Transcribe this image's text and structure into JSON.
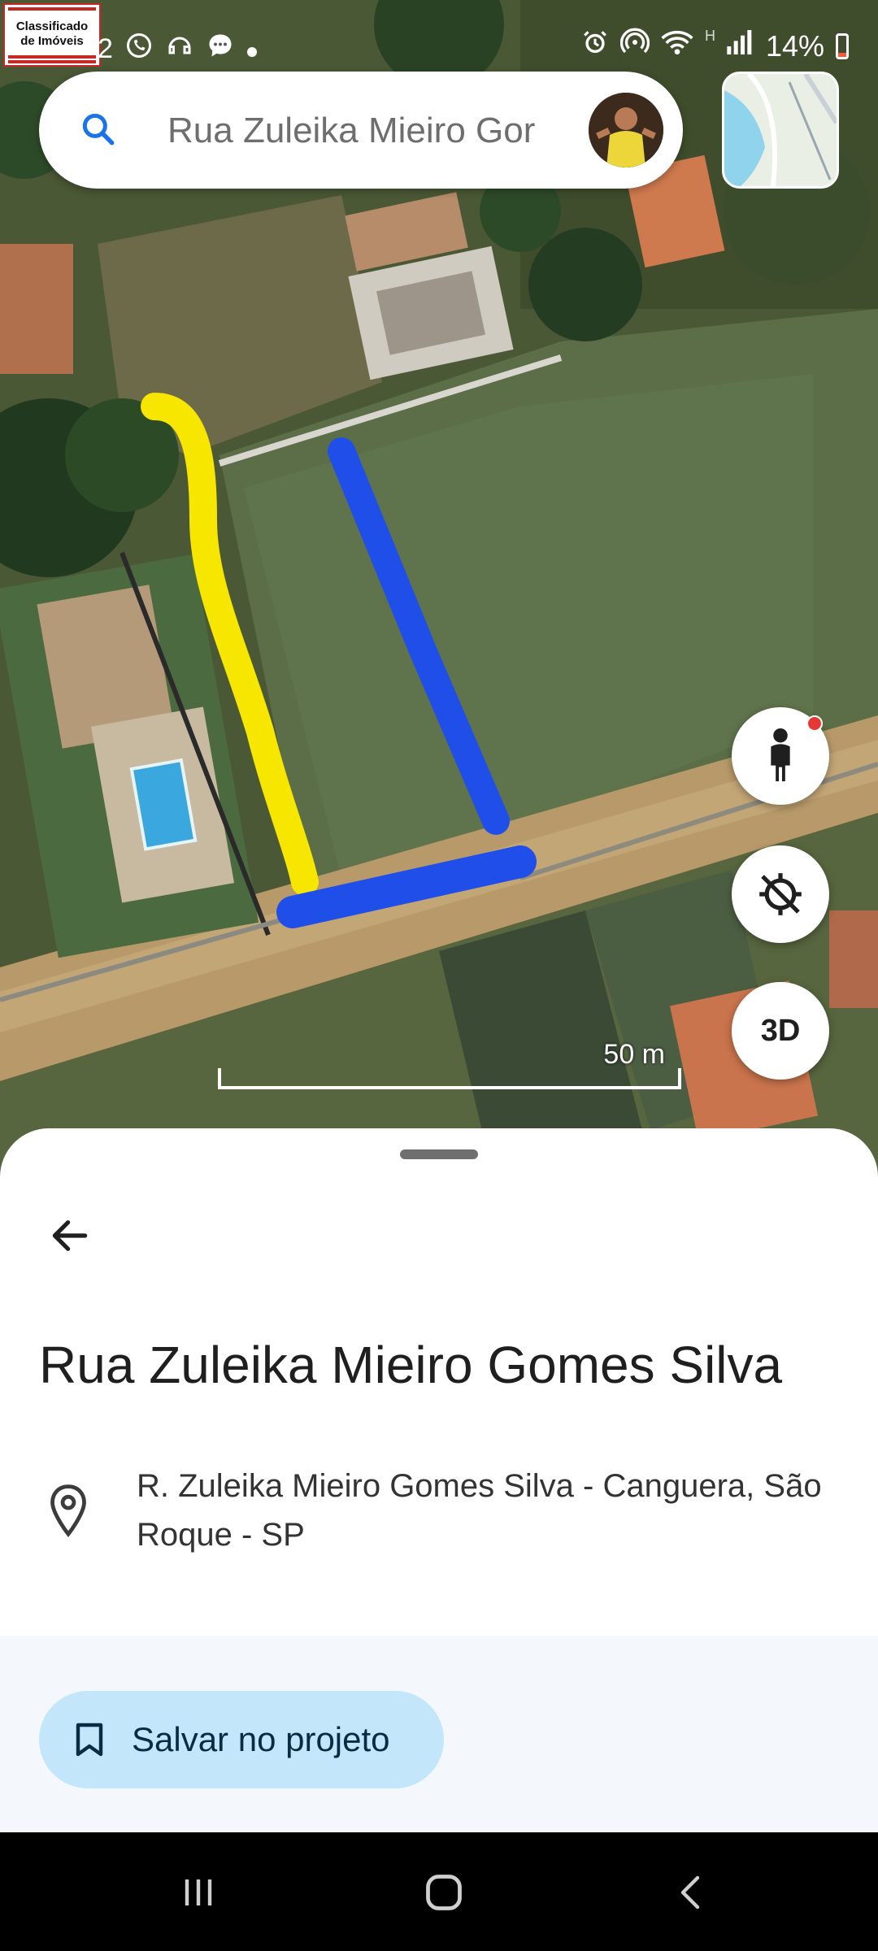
{
  "status_bar": {
    "logo_line1": "Classificado",
    "logo_line2": "de Imóveis",
    "notif_count": "2",
    "battery": "14%",
    "network_label": "H"
  },
  "search": {
    "value": "Rua Zuleika Mieiro Gor",
    "icon": "search-icon"
  },
  "map": {
    "scale_label": "50 m",
    "three_d_label": "3D",
    "markings": [
      {
        "name": "yellow-boundary-line",
        "color": "#f7e600"
      },
      {
        "name": "blue-boundary-line",
        "color": "#1f4fe8"
      }
    ]
  },
  "place": {
    "title": "Rua Zuleika Mieiro Gomes Silva",
    "address": "R. Zuleika Mieiro Gomes Silva - Canguera, São Roque - SP"
  },
  "actions": {
    "save_label": "Salvar no projeto"
  },
  "colors": {
    "accent": "#1a73e8",
    "save_button_bg": "#c3e6fb"
  }
}
